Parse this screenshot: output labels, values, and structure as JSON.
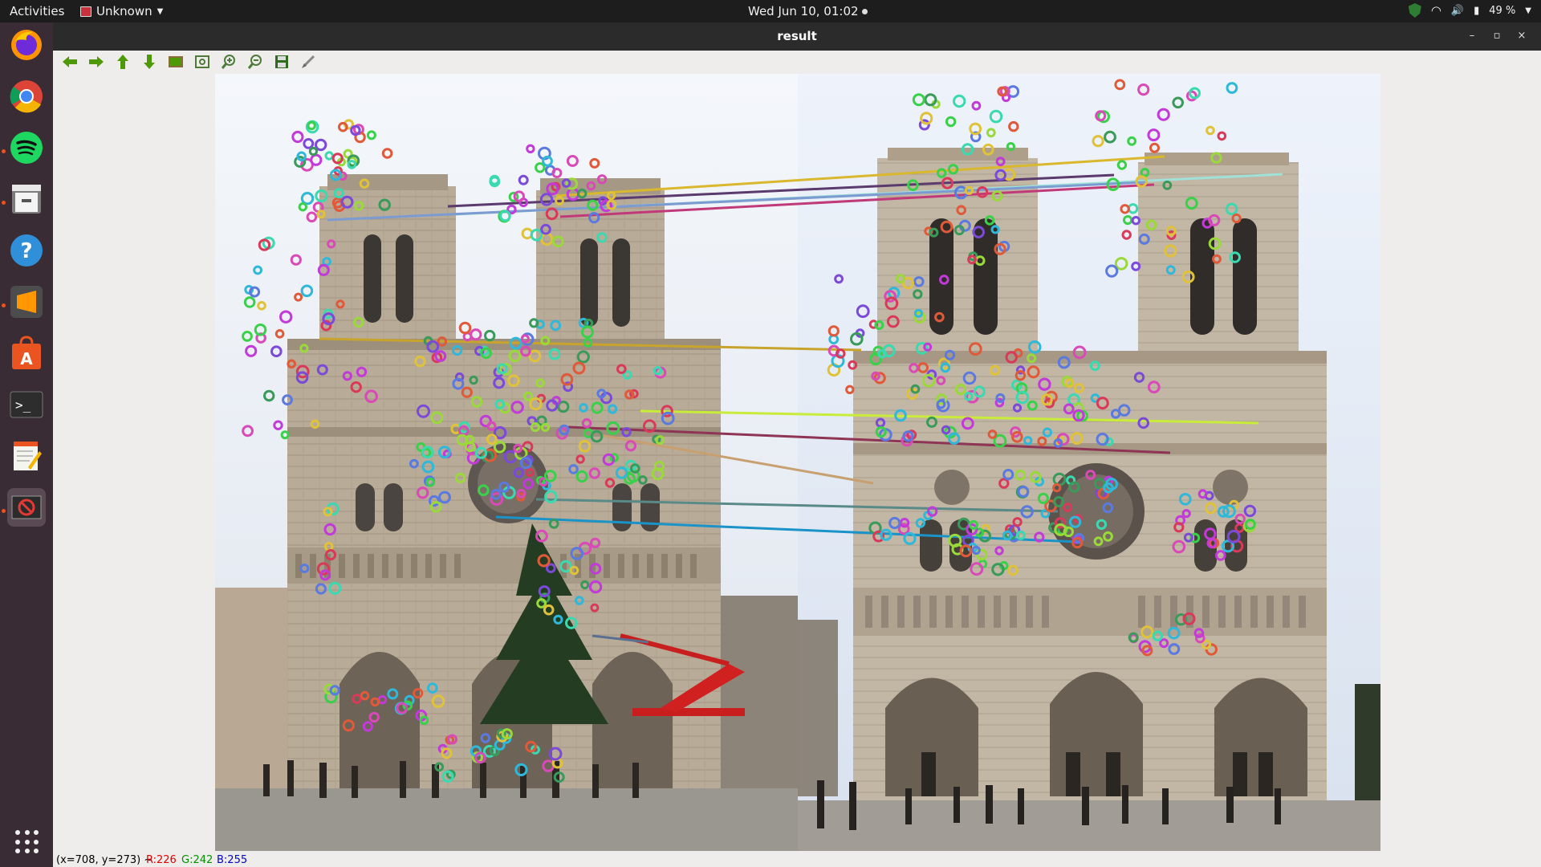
{
  "topbar": {
    "activities": "Activities",
    "app_name": "Unknown",
    "clock": "Wed Jun 10, 01:02",
    "battery": "49 %"
  },
  "dock": {
    "apps": [
      "firefox-icon",
      "chrome-icon",
      "spotify-icon",
      "files-icon",
      "help-icon",
      "sublime-text-icon",
      "software-center-icon",
      "terminal-icon",
      "text-editor-icon",
      "result-window-icon"
    ],
    "show_apps": "show-applications-icon"
  },
  "window": {
    "title": "result",
    "toolbar": [
      "pan-left",
      "pan-right",
      "pan-up",
      "pan-down",
      "zoom-in-original",
      "zoom-fit",
      "zoom-in",
      "zoom-out",
      "save",
      "properties"
    ]
  },
  "status": {
    "coords": "(x=708, y=273) ~",
    "r": "R:226",
    "g": "G:242",
    "b": "B:255"
  },
  "colors": {
    "accent": "#e95420",
    "dock_bg": "#3a2c34",
    "topbar_bg": "#1d1d1d",
    "titlebar_bg": "#2b2b2b",
    "r_color": "#e00000",
    "g_color": "#009000",
    "b_color": "#0000c8"
  }
}
